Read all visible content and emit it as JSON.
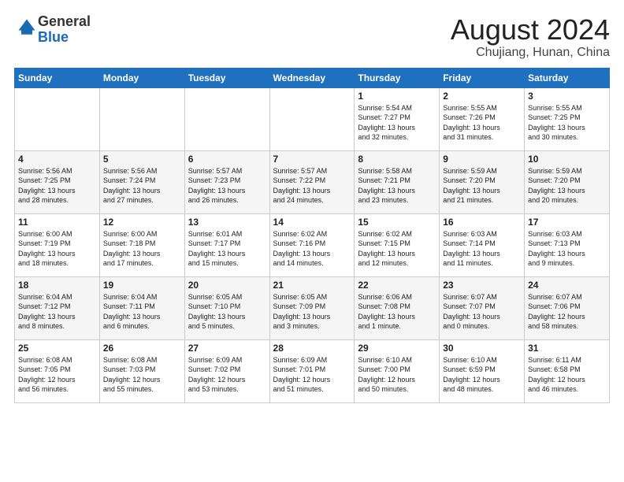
{
  "header": {
    "logo_general": "General",
    "logo_blue": "Blue",
    "month_title": "August 2024",
    "subtitle": "Chujiang, Hunan, China"
  },
  "weekdays": [
    "Sunday",
    "Monday",
    "Tuesday",
    "Wednesday",
    "Thursday",
    "Friday",
    "Saturday"
  ],
  "weeks": [
    [
      {
        "day": "",
        "info": ""
      },
      {
        "day": "",
        "info": ""
      },
      {
        "day": "",
        "info": ""
      },
      {
        "day": "",
        "info": ""
      },
      {
        "day": "1",
        "info": "Sunrise: 5:54 AM\nSunset: 7:27 PM\nDaylight: 13 hours\nand 32 minutes."
      },
      {
        "day": "2",
        "info": "Sunrise: 5:55 AM\nSunset: 7:26 PM\nDaylight: 13 hours\nand 31 minutes."
      },
      {
        "day": "3",
        "info": "Sunrise: 5:55 AM\nSunset: 7:25 PM\nDaylight: 13 hours\nand 30 minutes."
      }
    ],
    [
      {
        "day": "4",
        "info": "Sunrise: 5:56 AM\nSunset: 7:25 PM\nDaylight: 13 hours\nand 28 minutes."
      },
      {
        "day": "5",
        "info": "Sunrise: 5:56 AM\nSunset: 7:24 PM\nDaylight: 13 hours\nand 27 minutes."
      },
      {
        "day": "6",
        "info": "Sunrise: 5:57 AM\nSunset: 7:23 PM\nDaylight: 13 hours\nand 26 minutes."
      },
      {
        "day": "7",
        "info": "Sunrise: 5:57 AM\nSunset: 7:22 PM\nDaylight: 13 hours\nand 24 minutes."
      },
      {
        "day": "8",
        "info": "Sunrise: 5:58 AM\nSunset: 7:21 PM\nDaylight: 13 hours\nand 23 minutes."
      },
      {
        "day": "9",
        "info": "Sunrise: 5:59 AM\nSunset: 7:20 PM\nDaylight: 13 hours\nand 21 minutes."
      },
      {
        "day": "10",
        "info": "Sunrise: 5:59 AM\nSunset: 7:20 PM\nDaylight: 13 hours\nand 20 minutes."
      }
    ],
    [
      {
        "day": "11",
        "info": "Sunrise: 6:00 AM\nSunset: 7:19 PM\nDaylight: 13 hours\nand 18 minutes."
      },
      {
        "day": "12",
        "info": "Sunrise: 6:00 AM\nSunset: 7:18 PM\nDaylight: 13 hours\nand 17 minutes."
      },
      {
        "day": "13",
        "info": "Sunrise: 6:01 AM\nSunset: 7:17 PM\nDaylight: 13 hours\nand 15 minutes."
      },
      {
        "day": "14",
        "info": "Sunrise: 6:02 AM\nSunset: 7:16 PM\nDaylight: 13 hours\nand 14 minutes."
      },
      {
        "day": "15",
        "info": "Sunrise: 6:02 AM\nSunset: 7:15 PM\nDaylight: 13 hours\nand 12 minutes."
      },
      {
        "day": "16",
        "info": "Sunrise: 6:03 AM\nSunset: 7:14 PM\nDaylight: 13 hours\nand 11 minutes."
      },
      {
        "day": "17",
        "info": "Sunrise: 6:03 AM\nSunset: 7:13 PM\nDaylight: 13 hours\nand 9 minutes."
      }
    ],
    [
      {
        "day": "18",
        "info": "Sunrise: 6:04 AM\nSunset: 7:12 PM\nDaylight: 13 hours\nand 8 minutes."
      },
      {
        "day": "19",
        "info": "Sunrise: 6:04 AM\nSunset: 7:11 PM\nDaylight: 13 hours\nand 6 minutes."
      },
      {
        "day": "20",
        "info": "Sunrise: 6:05 AM\nSunset: 7:10 PM\nDaylight: 13 hours\nand 5 minutes."
      },
      {
        "day": "21",
        "info": "Sunrise: 6:05 AM\nSunset: 7:09 PM\nDaylight: 13 hours\nand 3 minutes."
      },
      {
        "day": "22",
        "info": "Sunrise: 6:06 AM\nSunset: 7:08 PM\nDaylight: 13 hours\nand 1 minute."
      },
      {
        "day": "23",
        "info": "Sunrise: 6:07 AM\nSunset: 7:07 PM\nDaylight: 13 hours\nand 0 minutes."
      },
      {
        "day": "24",
        "info": "Sunrise: 6:07 AM\nSunset: 7:06 PM\nDaylight: 12 hours\nand 58 minutes."
      }
    ],
    [
      {
        "day": "25",
        "info": "Sunrise: 6:08 AM\nSunset: 7:05 PM\nDaylight: 12 hours\nand 56 minutes."
      },
      {
        "day": "26",
        "info": "Sunrise: 6:08 AM\nSunset: 7:03 PM\nDaylight: 12 hours\nand 55 minutes."
      },
      {
        "day": "27",
        "info": "Sunrise: 6:09 AM\nSunset: 7:02 PM\nDaylight: 12 hours\nand 53 minutes."
      },
      {
        "day": "28",
        "info": "Sunrise: 6:09 AM\nSunset: 7:01 PM\nDaylight: 12 hours\nand 51 minutes."
      },
      {
        "day": "29",
        "info": "Sunrise: 6:10 AM\nSunset: 7:00 PM\nDaylight: 12 hours\nand 50 minutes."
      },
      {
        "day": "30",
        "info": "Sunrise: 6:10 AM\nSunset: 6:59 PM\nDaylight: 12 hours\nand 48 minutes."
      },
      {
        "day": "31",
        "info": "Sunrise: 6:11 AM\nSunset: 6:58 PM\nDaylight: 12 hours\nand 46 minutes."
      }
    ]
  ]
}
